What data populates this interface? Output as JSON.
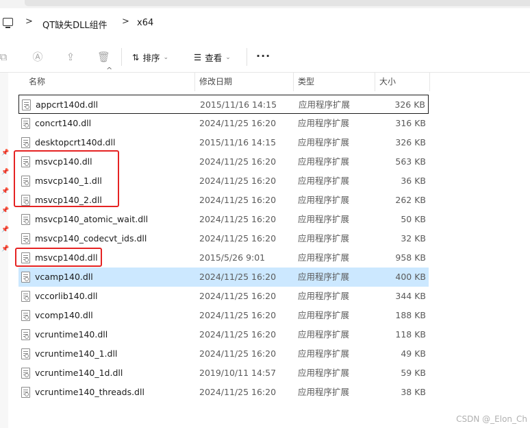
{
  "colors": {
    "accent_highlight": "#e52222",
    "selected_row": "#cce8ff"
  },
  "breadcrumb": {
    "items": [
      "QT缺失DLL组件",
      "x64"
    ],
    "separator": ">"
  },
  "toolbar": {
    "sort_label": "排序",
    "view_label": "查看",
    "more_label": "···"
  },
  "columns": {
    "name": "名称",
    "modified": "修改日期",
    "type": "类型",
    "size": "大小"
  },
  "files": [
    {
      "name": "appcrt140d.dll",
      "modified": "2015/11/16 14:15",
      "type": "应用程序扩展",
      "size": "326 KB"
    },
    {
      "name": "concrt140.dll",
      "modified": "2024/11/25 16:20",
      "type": "应用程序扩展",
      "size": "316 KB"
    },
    {
      "name": "desktopcrt140d.dll",
      "modified": "2015/11/16 14:15",
      "type": "应用程序扩展",
      "size": "326 KB"
    },
    {
      "name": "msvcp140.dll",
      "modified": "2024/11/25 16:20",
      "type": "应用程序扩展",
      "size": "563 KB"
    },
    {
      "name": "msvcp140_1.dll",
      "modified": "2024/11/25 16:20",
      "type": "应用程序扩展",
      "size": "36 KB"
    },
    {
      "name": "msvcp140_2.dll",
      "modified": "2024/11/25 16:20",
      "type": "应用程序扩展",
      "size": "262 KB"
    },
    {
      "name": "msvcp140_atomic_wait.dll",
      "modified": "2024/11/25 16:20",
      "type": "应用程序扩展",
      "size": "50 KB"
    },
    {
      "name": "msvcp140_codecvt_ids.dll",
      "modified": "2024/11/25 16:20",
      "type": "应用程序扩展",
      "size": "32 KB"
    },
    {
      "name": "msvcp140d.dll",
      "modified": "2015/5/26 9:01",
      "type": "应用程序扩展",
      "size": "958 KB"
    },
    {
      "name": "vcamp140.dll",
      "modified": "2024/11/25 16:20",
      "type": "应用程序扩展",
      "size": "400 KB"
    },
    {
      "name": "vccorlib140.dll",
      "modified": "2024/11/25 16:20",
      "type": "应用程序扩展",
      "size": "344 KB"
    },
    {
      "name": "vcomp140.dll",
      "modified": "2024/11/25 16:20",
      "type": "应用程序扩展",
      "size": "188 KB"
    },
    {
      "name": "vcruntime140.dll",
      "modified": "2024/11/25 16:20",
      "type": "应用程序扩展",
      "size": "118 KB"
    },
    {
      "name": "vcruntime140_1.dll",
      "modified": "2024/11/25 16:20",
      "type": "应用程序扩展",
      "size": "49 KB"
    },
    {
      "name": "vcruntime140_1d.dll",
      "modified": "2019/10/11 14:57",
      "type": "应用程序扩展",
      "size": "59 KB"
    },
    {
      "name": "vcruntime140_threads.dll",
      "modified": "2024/11/25 16:20",
      "type": "应用程序扩展",
      "size": "38 KB"
    }
  ],
  "watermark": "CSDN @_Elon_Ch"
}
